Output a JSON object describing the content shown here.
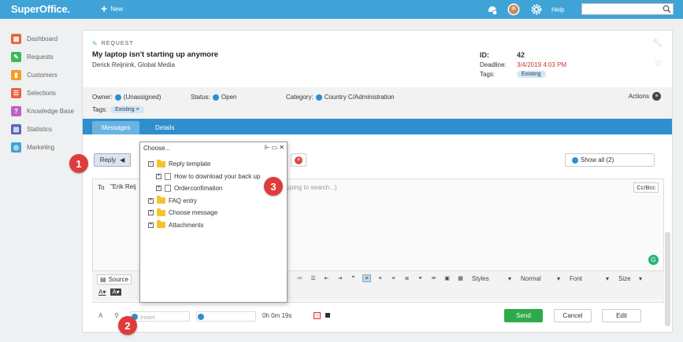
{
  "topbar": {
    "logo": "SuperOffice.",
    "new_label": "New",
    "help_label": "Help",
    "search_placeholder": ""
  },
  "sidebar": {
    "items": [
      {
        "label": "Dashboard",
        "icon": "dashboard-icon",
        "color": "#e8643c"
      },
      {
        "label": "Requests",
        "icon": "requests-icon",
        "color": "#3cba5a"
      },
      {
        "label": "Customers",
        "icon": "customers-icon",
        "color": "#f0a020"
      },
      {
        "label": "Selections",
        "icon": "selections-icon",
        "color": "#e8643c"
      },
      {
        "label": "Knowledge Base",
        "icon": "knowledge-base-icon",
        "color": "#c060c0"
      },
      {
        "label": "Statistics",
        "icon": "statistics-icon",
        "color": "#5a6ab4"
      },
      {
        "label": "Marketing",
        "icon": "marketing-icon",
        "color": "#3fa3d8"
      }
    ]
  },
  "request": {
    "type_label": "REQUEST",
    "title": "My laptop isn't starting up anymore",
    "contact": "Derick Reijnink, Global Media",
    "id_label": "ID:",
    "id_value": "42",
    "deadline_label": "Deadline:",
    "deadline_value": "3/4/2019 4:03 PM",
    "tags_label": "Tags:",
    "tag_value": "Existing"
  },
  "info": {
    "owner_label": "Owner:",
    "owner_value": "(Unassigned)",
    "status_label": "Status:",
    "status_value": "Open",
    "category_label": "Category:",
    "category_value": "Country C/Administration",
    "actions_label": "Actions",
    "tags_label": "Tags:",
    "tag_chip": "Existing ×"
  },
  "tabs": {
    "messages": "Messages",
    "details": "Details"
  },
  "compose": {
    "reply_label": "Reply",
    "show_all_label": "Show all (2)",
    "to_label": "To",
    "to_recipient": "\"Erik Reij",
    "to_search_hint": "yping to search...)",
    "ccbcc_label": "Cc/Bcc",
    "source_label": "Source",
    "styles_label": "Styles",
    "format_label": "Normal",
    "font_label": "Font",
    "size_label": "Size",
    "insert_placeholder": "Insert",
    "time_value": "0h 0m 19s",
    "send_label": "Send",
    "cancel_label": "Cancel",
    "edit_label": "Edit"
  },
  "dialog": {
    "title": "Choose...",
    "tree": [
      {
        "label": "Reply template",
        "level": 0,
        "type": "folder",
        "toggle": "−"
      },
      {
        "label": "How to download your back up",
        "level": 1,
        "type": "doc",
        "toggle": "+"
      },
      {
        "label": "Orderconfimation",
        "level": 1,
        "type": "doc",
        "toggle": "+"
      },
      {
        "label": "FAQ entry",
        "level": 0,
        "type": "folder",
        "toggle": "+"
      },
      {
        "label": "Choose message",
        "level": 0,
        "type": "folder",
        "toggle": "+"
      },
      {
        "label": "Attachments",
        "level": 0,
        "type": "folder",
        "toggle": "+"
      }
    ]
  },
  "callouts": [
    "1",
    "2",
    "3"
  ],
  "colors": {
    "topbar": "#3fa3d8",
    "tabbar": "#2e8fcc",
    "send": "#2faa4a",
    "callout": "#e03b3b"
  }
}
